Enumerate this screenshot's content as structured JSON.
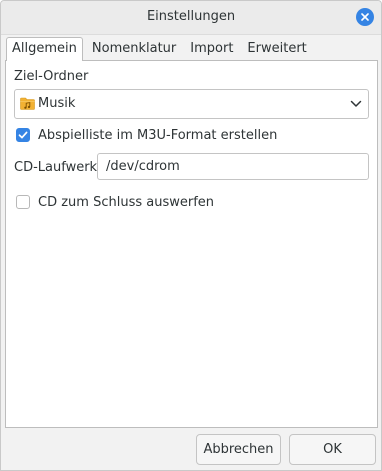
{
  "window": {
    "title": "Einstellungen"
  },
  "tabs": [
    {
      "label": "Allgemein",
      "active": true
    },
    {
      "label": "Nomenklatur",
      "active": false
    },
    {
      "label": "Import",
      "active": false
    },
    {
      "label": "Erweitert",
      "active": false
    }
  ],
  "general": {
    "target_folder_label": "Ziel-Ordner",
    "target_folder_value": "Musik",
    "target_folder_icon": "music-folder-icon",
    "playlist_checkbox": {
      "label": "Abspielliste im M3U-Format erstellen",
      "checked": true
    },
    "drive_label": "CD-Laufwerk:",
    "drive_value": "/dev/cdrom",
    "eject_checkbox": {
      "label": "CD zum Schluss auswerfen",
      "checked": false
    }
  },
  "buttons": {
    "cancel_label": "Abbrechen",
    "ok_label": "OK"
  },
  "colors": {
    "accent": "#3584e4",
    "folder": "#f2b132"
  }
}
